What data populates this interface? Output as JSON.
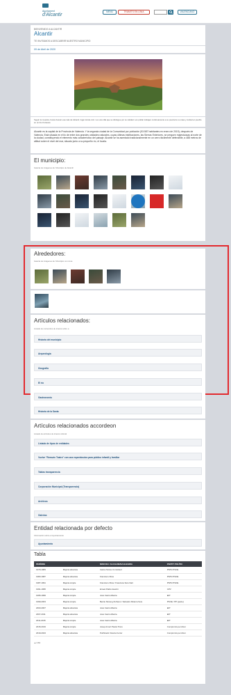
{
  "header": {
    "logo_line1": "Ajuntament",
    "logo_line2": "d'Alcantir",
    "btn1": "MENÚ",
    "btn2": "TRÀMITS EN LÍNIA",
    "btn3": "VALENCIANO",
    "search_placeholder": ""
  },
  "page": {
    "breadcrumb": "BIENVENIDO A ALCANTIR",
    "title": "Alcantir",
    "subtitle": "TE INVITAMOS A DESCUBRIR NUESTRO MUNICIPIO",
    "date": "09 de Abril de 2020",
    "caption": "Seguir la muestra, busca buscar esa más de Alcantir, lugar donde vivir. Los una villa que se distingue por su calidad. Los poblar trabajen continuamente a su puerta de su casa y cuidad en pueblo en un tiro fronteras.",
    "paragraph": "Alcantir es la capital de la Provincia de Valencia. Y la segunda ciudad de la Comunidad por población (53.587 habitantes en enero de 2019), después de Valencia. Está situada en el ilo de entre dos grandes unidades naturales, cuyas últimas estribaciones, las Sierras Exteriores, se perguen majestuosas al norte de la ciudad, constituyendo el elemento más característico del paisaje. Alcantir se ha asentado tradicionalmente en un cerro fácilmente defendible, a 488 metros de altitud sobre el nivel del mar, situado junto a su pequeño río, el Isuela."
  },
  "municipio": {
    "title": "El municipio:",
    "subtitle": "Galería de imágenes de: Municipio de Alcantir"
  },
  "alrededores": {
    "title": "Alrededores:",
    "subtitle": "Galería de imágenes de: Municipio con zona"
  },
  "articulos": {
    "title": "Artículos relacionados:",
    "subtitle": "Listado de contenidos de interés sobre a",
    "items": [
      "Historia del municipio",
      "Arqueología",
      "Geografía",
      "El río",
      "Gastronomía",
      "Historia de la Santa"
    ]
  },
  "accordeon": {
    "title": "Artículos relacionados accordeon",
    "subtitle": "Listado de artículos de interés cultural",
    "items": [
      "Listado de tipos de entidades",
      "Vuelve \"Remuén Teatro\" con una espectáculos para público infantil y familiar",
      "Tablas transparencia",
      "Corporación Municipal (Transparencia)",
      "Archivos",
      "Galerías"
    ]
  },
  "entidad": {
    "title": "Entidad relacionada por defecto",
    "subtitle": "Información sobre el ayuntamiento",
    "item": "Ayuntamiento"
  },
  "tabla": {
    "title": "Tabla",
    "headers": [
      "PERÍODE",
      "",
      "NOM DE L'ALCALDE/SA ELEGIDA",
      "PARTIT POLÍTIC"
    ],
    "rows": [
      [
        "1979-1983",
        "Majoria absoluta",
        "Carlos Tarrés Un Gisbert",
        "PSPV-PSOE"
      ],
      [
        "1983-1987",
        "Majoria absoluta",
        "Francisco Oliva",
        "PSPV-PSOE"
      ],
      [
        "1987-1991",
        "Majoria simple",
        "Francisco Oliva / Francisca Soto Nart",
        "PSPV-PSOE"
      ],
      [
        "1991-1995",
        "Majoria simple",
        "Ernest Pablo Giambi",
        "CPV"
      ],
      [
        "1995-1999",
        "Majoria simple",
        "José Cantó Albarra",
        "E/P"
      ],
      [
        "1999-2003",
        "Majoria simple",
        "Benito Moreng Zurbano i Salvador Albarca Soto",
        "PSOE / PP (pacte)"
      ],
      [
        "2003-2007",
        "Majoria absoluta",
        "José Cantó Albarra",
        "E/P"
      ],
      [
        "2007-2011",
        "Majoria absoluta",
        "José Cantó Albarra",
        "E/P"
      ],
      [
        "2011-2015",
        "Majoria simple",
        "José Cantó Albarra",
        "E/P"
      ],
      [
        "2015-2019",
        "Majoria simple",
        "Josep Arnert Pastor Pons",
        "Compromís per Alcoi"
      ],
      [
        "2019-2023",
        "Majoria absoluta",
        "Purificació Vicente Ferrer",
        "Compromís per Alcoi"
      ]
    ],
    "version": "▲ CSV"
  }
}
